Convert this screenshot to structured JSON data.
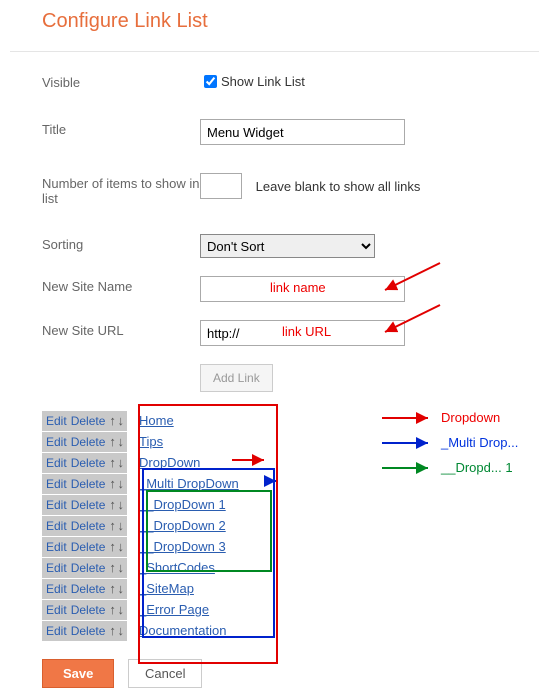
{
  "page_title": "Configure Link List",
  "visible": {
    "label": "Visible",
    "checkbox_label": "Show Link List",
    "checked": true
  },
  "title": {
    "label": "Title",
    "value": "Menu Widget"
  },
  "num_items": {
    "label": "Number of items to show in list",
    "value": "",
    "hint": "Leave blank to show all links"
  },
  "sorting": {
    "label": "Sorting",
    "selected": "Don't Sort"
  },
  "new_site_name": {
    "label": "New Site Name",
    "value": "",
    "annotation": "link name"
  },
  "new_site_url": {
    "label": "New Site URL",
    "value": "http://",
    "annotation": "link URL"
  },
  "add_link_label": "Add Link",
  "row_actions": {
    "edit": "Edit",
    "delete": "Delete"
  },
  "link_items": [
    {
      "label": "Home"
    },
    {
      "label": "Tips"
    },
    {
      "label": "DropDown"
    },
    {
      "label": "_Multi DropDown"
    },
    {
      "label": "__DropDown 1"
    },
    {
      "label": "__DropDown 2"
    },
    {
      "label": "__DropDown 3"
    },
    {
      "label": "_ShortCodes"
    },
    {
      "label": "_SiteMap"
    },
    {
      "label": "_Error Page"
    },
    {
      "label": "Documentation"
    }
  ],
  "legend": {
    "dropdown": "Dropdown",
    "multi": "_Multi Drop...",
    "lvl2": "__Dropd... 1"
  },
  "buttons": {
    "save": "Save",
    "cancel": "Cancel"
  },
  "colors": {
    "outline_red": "#e10000",
    "outline_blue": "#0022cc",
    "outline_green": "#008822"
  }
}
